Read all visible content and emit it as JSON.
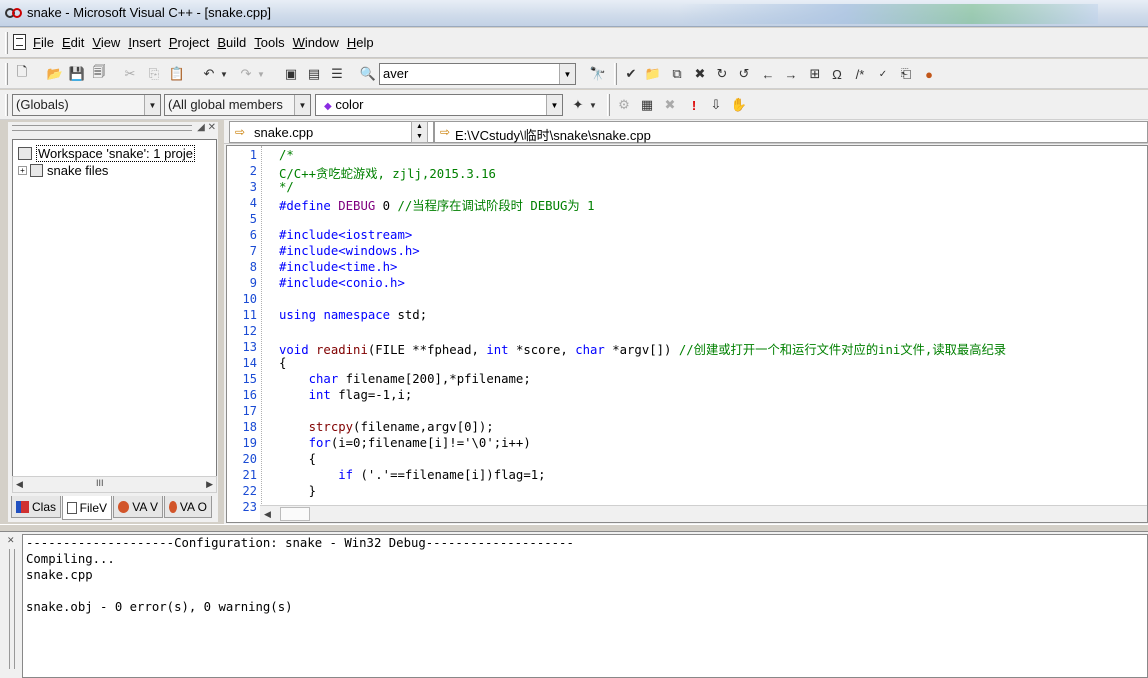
{
  "window": {
    "title": "snake - Microsoft Visual C++ - [snake.cpp]"
  },
  "menu": {
    "items": [
      {
        "accel": "F",
        "rest": "ile"
      },
      {
        "accel": "E",
        "rest": "dit"
      },
      {
        "accel": "V",
        "rest": "iew"
      },
      {
        "accel": "I",
        "rest": "nsert"
      },
      {
        "accel": "P",
        "rest": "roject"
      },
      {
        "accel": "B",
        "rest": "uild"
      },
      {
        "accel": "T",
        "rest": "ools"
      },
      {
        "accel": "W",
        "rest": "indow"
      },
      {
        "accel": "H",
        "rest": "elp"
      }
    ]
  },
  "toolbar1": {
    "find_value": "aver"
  },
  "toolbar2": {
    "scope": "(Globals)",
    "members": "(All global members",
    "symbol": "color"
  },
  "workspace": {
    "root": "Workspace 'snake': 1 proje",
    "child": "snake files",
    "scroll_mid": "III",
    "tabs": [
      "Clas",
      "FileV",
      "VA V",
      "VA O"
    ]
  },
  "editor": {
    "file_name": "snake.cpp",
    "path": "E:\\VCstudy\\临时\\snake\\snake.cpp",
    "line_numbers": [
      "1",
      "2",
      "3",
      "4",
      "5",
      "6",
      "7",
      "8",
      "9",
      "10",
      "11",
      "12",
      "13",
      "14",
      "15",
      "16",
      "17",
      "18",
      "19",
      "20",
      "21",
      "22",
      "23"
    ]
  },
  "code": {
    "l1": "/*",
    "l2": "C/C++贪吃蛇游戏, zjlj,2015.3.16",
    "l3": "*/",
    "l4_kw": "#define",
    "l4_macro": "DEBUG",
    "l4_rest": " 0 ",
    "l4_cm": "//当程序在调试阶段时 DEBUG为 1",
    "l6": "#include<iostream>",
    "l7": "#include<windows.h>",
    "l8": "#include<time.h>",
    "l9": "#include<conio.h>",
    "l11_a": "using",
    "l11_b": "namespace",
    "l11_c": " std;",
    "l13_void": "void",
    "l13_fn": "readini",
    "l13_a": "(FILE **fphead, ",
    "l13_int": "int",
    "l13_b": " *score, ",
    "l13_char": "char",
    "l13_c": " *argv[]) ",
    "l13_cm": "//创建或打开一个和运行文件对应的ini文件,读取最高纪录",
    "l14": "{",
    "l15_char": "char",
    "l15_rest": " filename[200],*pfilename;",
    "l16_int": "int",
    "l16_rest": " flag=-1,i;",
    "l18_fn": "strcpy",
    "l18_rest": "(filename,argv[0]);",
    "l19_for": "for",
    "l19_rest": "(i=0;filename[i]!='\\0';i++)",
    "l20": "{",
    "l21_if": "if",
    "l21_rest": " ('.'==filename[i])flag=1;",
    "l22": "}"
  },
  "output": {
    "lines": [
      "--------------------Configuration: snake - Win32 Debug--------------------",
      "Compiling...",
      "snake.cpp",
      "",
      "snake.obj - 0 error(s), 0 warning(s)"
    ]
  },
  "colors": {
    "comment": "#008000",
    "keyword": "#0000ff",
    "macro": "#800080",
    "line_number": "#1a4bd4"
  }
}
